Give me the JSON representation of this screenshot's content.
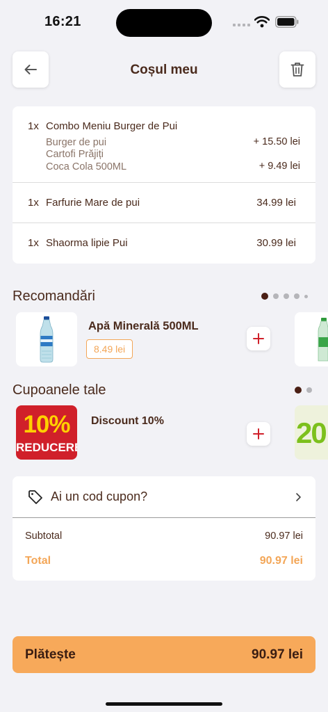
{
  "status_bar": {
    "time": "16:21"
  },
  "header": {
    "title": "Coșul meu"
  },
  "cart": {
    "items": [
      {
        "qty": "1x",
        "name": "Combo Meniu Burger de Pui",
        "price": "",
        "options": [
          {
            "name": "Burger de pui",
            "price": "+ 15.50 lei"
          },
          {
            "name": "Cartofi Prăjiți",
            "price": ""
          },
          {
            "name": "Coca Cola 500ML",
            "price": "+ 9.49 lei"
          }
        ]
      },
      {
        "qty": "1x",
        "name": "Farfurie Mare de pui",
        "price": "34.99 lei"
      },
      {
        "qty": "1x",
        "name": "Shaorma lipie Pui",
        "price": "30.99 lei"
      }
    ]
  },
  "recommendations": {
    "title": "Recomandări",
    "page_count": 5,
    "active_page": 1,
    "items": [
      {
        "name": "Apă Minerală 500ML",
        "price": "8.49 lei"
      }
    ]
  },
  "coupons": {
    "title": "Cupoanele tale",
    "page_count": 2,
    "active_page": 1,
    "items": [
      {
        "name": "Discount 10%",
        "image_text_top": "10%",
        "image_text_bottom": "REDUCERE"
      }
    ],
    "next_image_text": "20"
  },
  "summary": {
    "coupon_prompt": "Ai un cod cupon?",
    "subtotal_label": "Subtotal",
    "subtotal_value": "90.97 lei",
    "total_label": "Total",
    "total_value": "90.97 lei"
  },
  "pay": {
    "label": "Plătește",
    "amount": "90.97 lei"
  },
  "colors": {
    "accent": "#f3a657",
    "pay_button": "#f7a95a",
    "text_brown": "#4a2a1c",
    "coupon_red": "#d0202a",
    "coupon_yellow": "#ffd000"
  }
}
